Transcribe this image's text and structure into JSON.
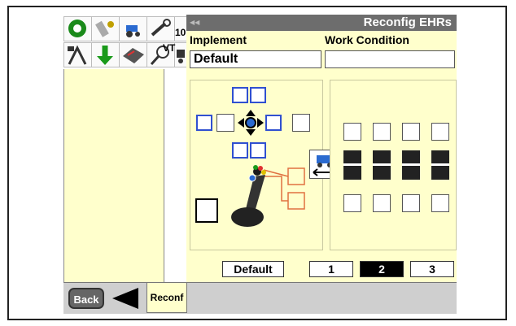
{
  "header": {
    "title": "Reconfig EHRs"
  },
  "toolbar_icons": [
    "gear-icon",
    "remote-icon",
    "tractor-icon",
    "wrench-icon",
    "gauge-10-icon",
    "antenna-icon",
    "download-arrow-icon",
    "book-icon",
    "magnifier-icon",
    "tractor-small-icon"
  ],
  "toolbar": {
    "vt_label": "VT",
    "ten_label": "10"
  },
  "fields": {
    "implement_label": "Implement",
    "implement_value": "Default",
    "work_condition_label": "Work Condition",
    "work_condition_value": ""
  },
  "buttons": {
    "default_label": "Default",
    "page_1": "1",
    "page_2": "2",
    "page_3": "3",
    "selected_page": "2"
  },
  "bottom": {
    "back_label": "Back",
    "tab_label": "Reconf"
  },
  "colors": {
    "background": "#ffffcc",
    "title_bar": "#6d6d6d",
    "accent_blue": "#3050d0",
    "link_orange": "#e07040"
  }
}
